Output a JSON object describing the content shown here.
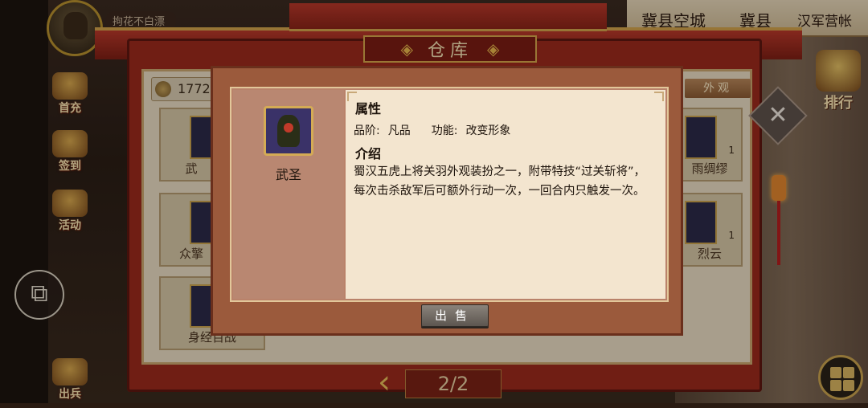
{
  "window": {
    "title": "仓库"
  },
  "player": {
    "name": "拘花不白漂"
  },
  "location": {
    "parts": [
      "冀县空城",
      "冀县",
      "汉军营帐"
    ]
  },
  "sidebar": {
    "items": [
      {
        "label": "首充",
        "icon": "treasure-chest-icon"
      },
      {
        "label": "签到",
        "icon": "scroll-brush-icon"
      },
      {
        "label": "活动",
        "icon": "drum-icon"
      },
      {
        "label": "出兵",
        "icon": "war-drum-icon"
      }
    ]
  },
  "right_panel": {
    "rank_label": "排行"
  },
  "warehouse": {
    "gold": "1772",
    "tab_appearance": "外观",
    "left_cards": [
      {
        "name": "武"
      },
      {
        "name": "众擎"
      },
      {
        "name": "身经百战"
      }
    ],
    "right_cards": [
      {
        "name": "雨绸缪",
        "count": "1"
      },
      {
        "name": "烈云",
        "count": "1"
      }
    ],
    "pagination": "2/2"
  },
  "item_dialog": {
    "item_name": "武圣",
    "section_attributes": "属性",
    "grade_label": "品阶:",
    "grade_value": "凡品",
    "function_label": "功能:",
    "function_value": "改变形象",
    "section_intro": "介绍",
    "description": "蜀汉五虎上将关羽外观装扮之一，附带特技“过关斩将”，每次击杀敌军后可额外行动一次，一回合内只触发一次。",
    "sell_button": "出售"
  },
  "colors": {
    "frame_red": "#9b2a1c",
    "gold_trim": "#d4a64a",
    "dialog_paper": "#f3e5cf"
  }
}
